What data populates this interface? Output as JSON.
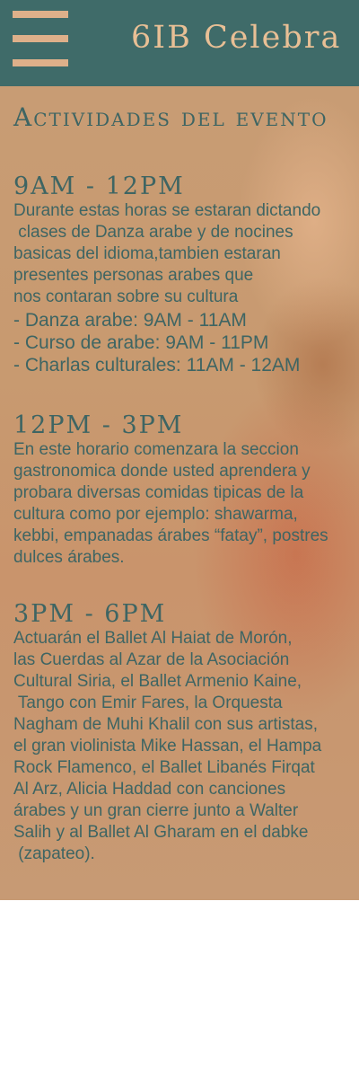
{
  "header": {
    "title": "6IB Celebra",
    "menu_icon": "hamburger-menu-icon",
    "background_color": "#3f6b69",
    "accent_color": "#deb08a"
  },
  "main": {
    "heading": "Actividades del evento",
    "blocks": [
      {
        "time": "9AM - 12PM",
        "lines": [
          "Durante estas horas se estaran dictando",
          " clases de Danza arabe y de nocines",
          "basicas del idioma,tambien estaran",
          "presentes personas arabes que",
          "nos contaran sobre su cultura"
        ],
        "items": [
          "- Danza arabe: 9AM - 11AM",
          "- Curso de arabe: 9AM - 11PM",
          "- Charlas culturales: 11AM - 12AM"
        ]
      },
      {
        "time": "12PM - 3PM",
        "lines": [
          "En este horario comenzara la seccion",
          "gastronomica donde usted aprendera y",
          "probara diversas comidas tipicas de la",
          "cultura como por ejemplo: shawarma,",
          "kebbi, empanadas árabes “fatay”, postres",
          "dulces árabes."
        ]
      },
      {
        "time": "3PM - 6PM",
        "lines": [
          "Actuarán el Ballet Al Haiat de Morón,",
          "las Cuerdas al Azar de la Asociación",
          "Cultural Siria, el Ballet Armenio Kaine,",
          " Tango con Emir Fares, la Orquesta",
          "Nagham de Muhi Khalil con sus artistas,",
          "el gran violinista Mike Hassan, el Hampa",
          "Rock Flamenco, el Ballet Libanés Firqat",
          "Al Arz, Alicia Haddad con canciones",
          "árabes y un gran cierre junto a Walter",
          "Salih y al Ballet Al Gharam en el dabke",
          " (zapateo)."
        ]
      }
    ]
  }
}
